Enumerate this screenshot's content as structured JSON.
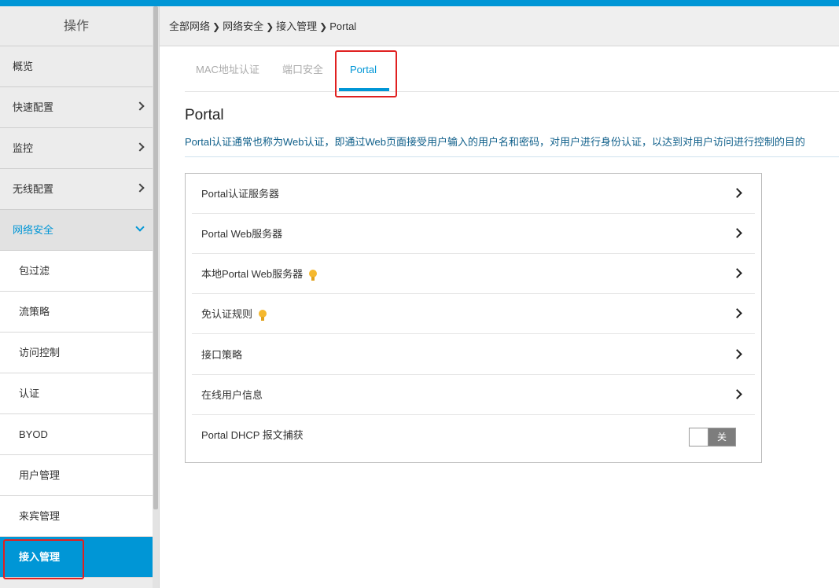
{
  "sidebar": {
    "header": "操作",
    "items": [
      {
        "label": "概览"
      },
      {
        "label": "快速配置"
      },
      {
        "label": "监控"
      },
      {
        "label": "无线配置"
      },
      {
        "label": "网络安全"
      }
    ],
    "sub_items": [
      {
        "label": "包过滤"
      },
      {
        "label": "流策略"
      },
      {
        "label": "访问控制"
      },
      {
        "label": "认证"
      },
      {
        "label": "BYOD"
      },
      {
        "label": "用户管理"
      },
      {
        "label": "来宾管理"
      },
      {
        "label": "接入管理"
      }
    ]
  },
  "breadcrumb": [
    "全部网络",
    "网络安全",
    "接入管理",
    "Portal"
  ],
  "tabs": [
    {
      "label": "MAC地址认证"
    },
    {
      "label": "端口安全"
    },
    {
      "label": "Portal"
    }
  ],
  "main": {
    "title": "Portal",
    "description": "Portal认证通常也称为Web认证，即通过Web页面接受用户输入的用户名和密码，对用户进行身份认证，以达到对用户访问进行控制的目的"
  },
  "rows": [
    {
      "label": "Portal认证服务器",
      "icon": "chevron-right-icon"
    },
    {
      "label": "Portal Web服务器",
      "icon": "chevron-right-icon"
    },
    {
      "label": "本地Portal Web服务器",
      "icon": "chevron-right-icon",
      "hint": "lightbulb-icon"
    },
    {
      "label": "免认证规则",
      "icon": "chevron-right-icon",
      "hint": "lightbulb-icon"
    },
    {
      "label": "接口策略",
      "icon": "chevron-right-icon"
    },
    {
      "label": "在线用户信息",
      "icon": "chevron-right-icon"
    },
    {
      "label": "Portal DHCP 报文捕获",
      "toggle": "关",
      "toggle_on": false
    }
  ],
  "colors": {
    "accent": "#0096d6",
    "highlight_box": "#e02020",
    "hint_bulb": "#f5b82e"
  }
}
